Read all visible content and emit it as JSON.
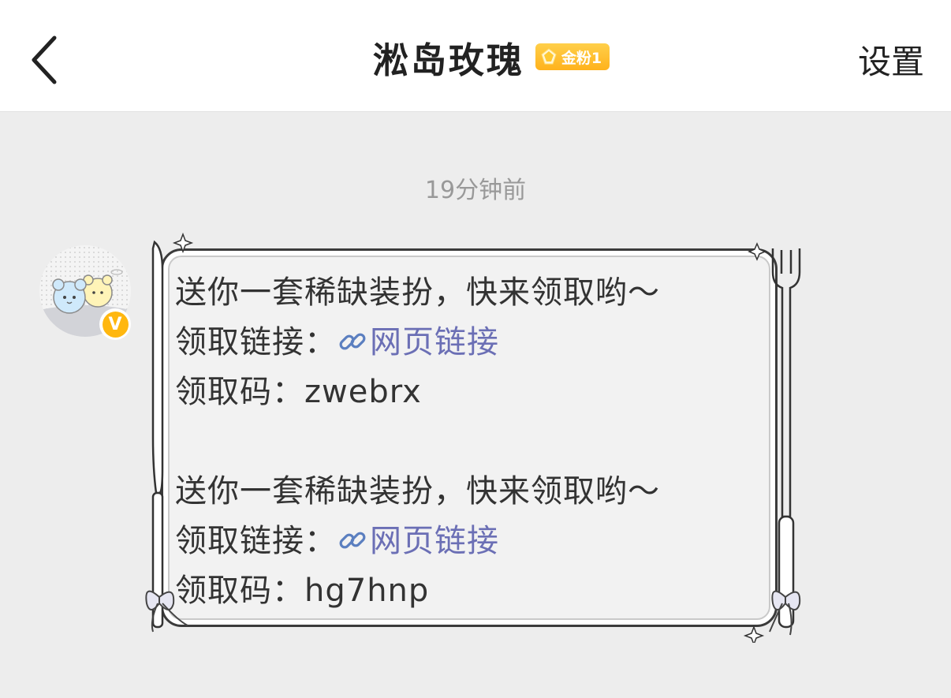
{
  "header": {
    "title": "淞岛玫瑰",
    "badge_label": "金粉1",
    "settings_label": "设置"
  },
  "chat": {
    "timestamp": "19分钟前",
    "message": {
      "block1": {
        "line1": "送你一套稀缺装扮，快来领取哟～",
        "link_prefix": "领取链接：",
        "link_text": "网页链接",
        "code_prefix": "领取码：",
        "code": "zwebrx"
      },
      "block2": {
        "line1": "送你一套稀缺装扮，快来领取哟～",
        "link_prefix": "领取链接：",
        "link_text": "网页链接",
        "code_prefix": "领取码：",
        "code": "hg7hnp"
      }
    }
  },
  "colors": {
    "background": "#ededed",
    "header_bg": "#ffffff",
    "link": "#6b6fb5",
    "badge": "#ffb21c",
    "verified": "#ffb70f"
  },
  "icons": {
    "back": "chevron-left-icon",
    "badge": "gem-icon",
    "link": "link-icon",
    "verified": "verified-v-icon"
  }
}
